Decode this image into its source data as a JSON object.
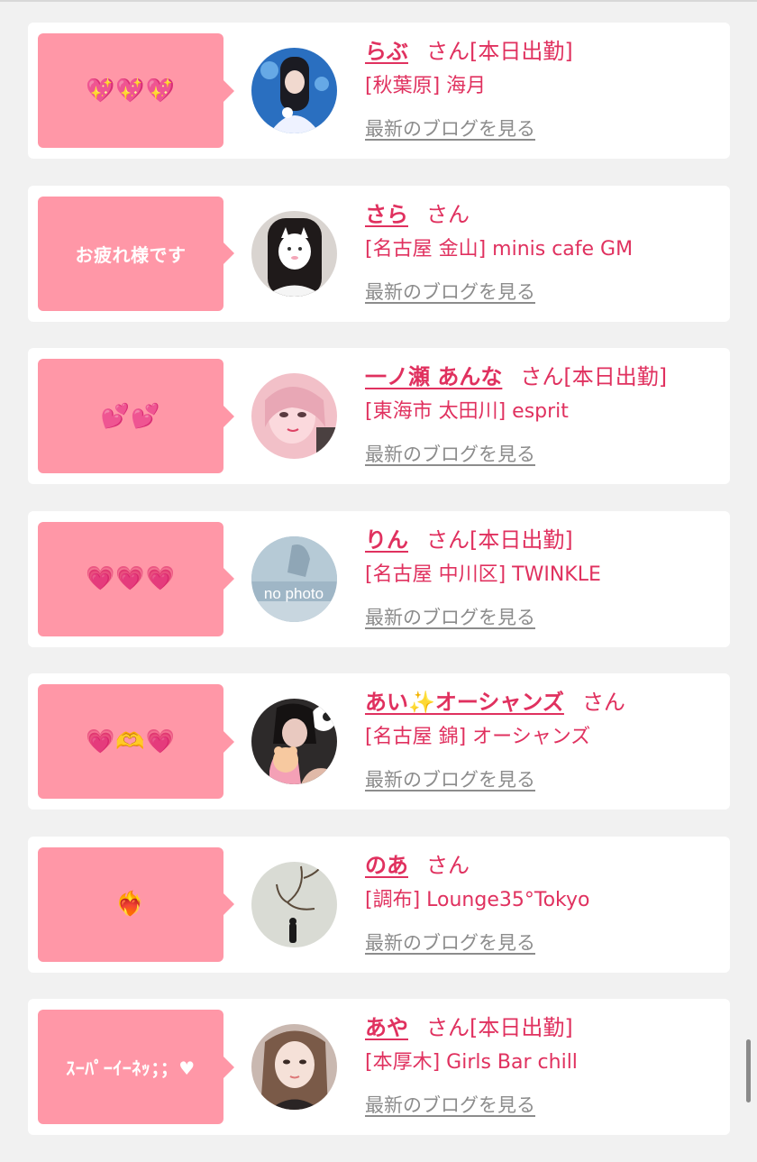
{
  "blog_link_text": "最新のブログを見る",
  "honorific": "さん",
  "colors": {
    "accent": "#e0315f",
    "bubble": "#ff97a7",
    "link": "#8c8c8c",
    "background": "#f1f1f1"
  },
  "cards": [
    {
      "message": "💖💖💖",
      "name": "らぶ",
      "status": "[本日出勤]",
      "shop": "[秋葉原] 海月",
      "avatar": "girl-photo"
    },
    {
      "message": "お疲れ様です",
      "name": "さら",
      "status": "",
      "shop": "[名古屋 金山] minis cafe GM",
      "avatar": "cat-mask-photo"
    },
    {
      "message": "💕💕",
      "name": "一ノ瀬 あんな",
      "status": "[本日出勤]",
      "shop": "[東海市 太田川] esprit",
      "avatar": "pink-filter-photo"
    },
    {
      "message": "💗💗💗",
      "name": "りん",
      "status": "[本日出勤]",
      "shop": "[名古屋 中川区] TWINKLE",
      "avatar": "no-photo",
      "avatar_text": "no photo"
    },
    {
      "message": "💗🫶💗",
      "name": "あい✨オーシャンズ",
      "status": "",
      "shop": "[名古屋 錦] オーシャンズ",
      "avatar": "heart-bear-photo"
    },
    {
      "message": "❤️‍🔥",
      "name": "のあ",
      "status": "",
      "shop": "[調布] Lounge35°Tokyo",
      "avatar": "branch-photo"
    },
    {
      "message": "ｽｰﾊﾟｰｲｰﾈｯ；；♥",
      "name": "あや",
      "status": "[本日出勤]",
      "shop": "[本厚木] Girls Bar chill",
      "avatar": "selfie-photo"
    }
  ]
}
